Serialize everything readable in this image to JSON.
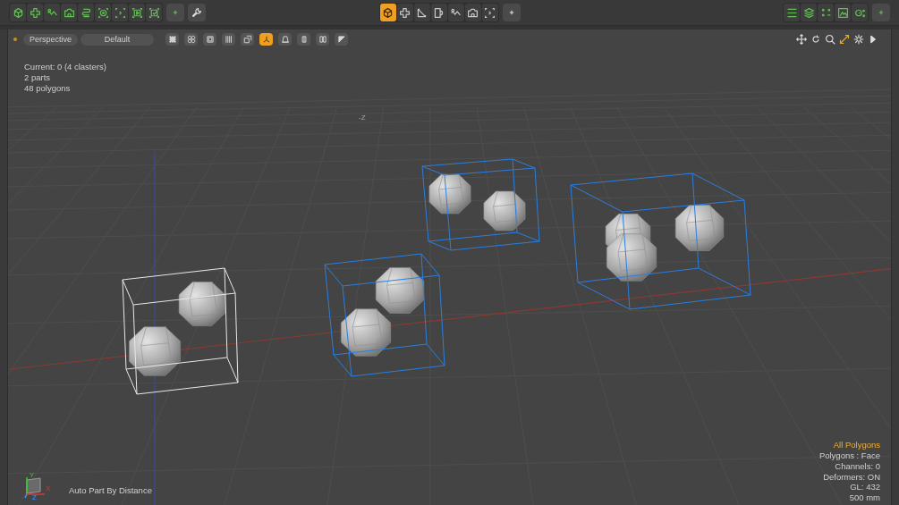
{
  "toolbar": {
    "groups": [
      {
        "kind": "green",
        "buttons": [
          {
            "selected": false
          },
          {
            "selected": false
          },
          {
            "selected": false
          },
          {
            "selected": false
          },
          {
            "selected": false
          },
          {
            "selected": false
          },
          {
            "selected": false
          },
          {
            "selected": false
          },
          {
            "selected": false
          }
        ]
      },
      {
        "kind": "plain",
        "buttons": [
          {
            "selected": true
          },
          {
            "selected": false
          },
          {
            "selected": false
          },
          {
            "selected": false
          },
          {
            "selected": false
          },
          {
            "selected": false
          },
          {
            "selected": false
          }
        ]
      },
      {
        "kind": "green",
        "buttons": [
          {
            "selected": false
          },
          {
            "selected": false
          },
          {
            "selected": false
          },
          {
            "selected": false
          },
          {
            "selected": false
          }
        ]
      }
    ]
  },
  "viewport_header": {
    "camera_menu": "Perspective",
    "display_menu": "Default",
    "buttons": [
      {
        "selected": false
      },
      {
        "selected": false
      },
      {
        "selected": false
      },
      {
        "selected": false
      },
      {
        "selected": false
      },
      {
        "selected": true
      },
      {
        "selected": false
      },
      {
        "selected": false
      },
      {
        "selected": false
      },
      {
        "selected": false
      }
    ]
  },
  "info": [
    "Current: 0 (4 clasters)",
    "2 parts",
    "48 polygons"
  ],
  "axis_label": "-Z",
  "clusters": [
    {
      "selected": true
    },
    {
      "selected": false
    },
    {
      "selected": false
    },
    {
      "selected": false
    }
  ],
  "status": [
    {
      "text": "All Polygons",
      "kind": "highlight"
    },
    {
      "text": "Polygons : Face",
      "kind": "normal"
    },
    {
      "text": "Channels: 0",
      "kind": "normal"
    },
    {
      "text": "Deformers: ON",
      "kind": "normal"
    },
    {
      "text": "GL: 432",
      "kind": "normal"
    },
    {
      "text": "500 mm",
      "kind": "normal"
    }
  ],
  "gizmo": {
    "y": "Y",
    "x": "X",
    "z": "Z"
  },
  "tool_name": "Auto Part By Distance"
}
